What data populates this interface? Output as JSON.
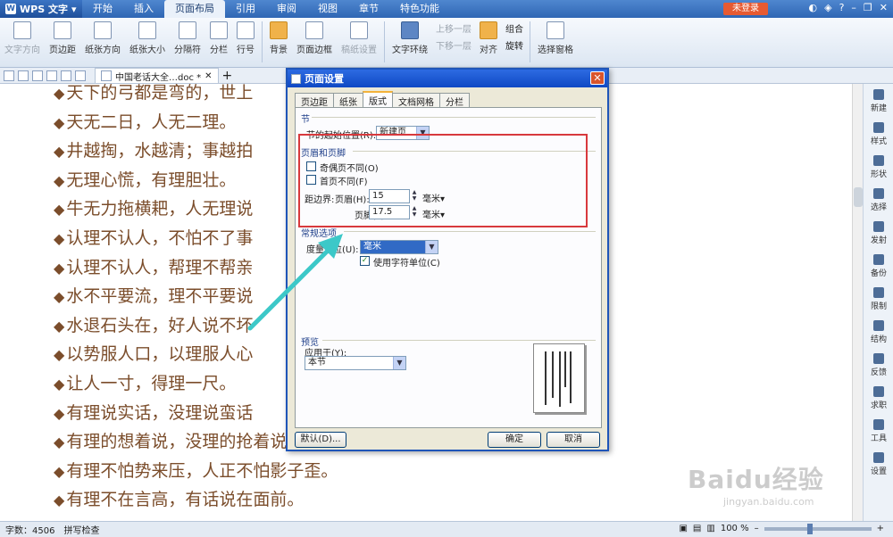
{
  "app": {
    "name": "WPS 文字",
    "login": "未登录"
  },
  "menu": [
    "开始",
    "插入",
    "页面布局",
    "引用",
    "审阅",
    "视图",
    "章节",
    "特色功能"
  ],
  "ribbon": {
    "text_direction": "文字方向",
    "margins": "页边距",
    "orientation": "纸张方向",
    "size": "纸张大小",
    "separator": "分隔符",
    "columns": "分栏",
    "line_numbers": "行号",
    "background": "背景",
    "page_border": "页面边框",
    "draft_settings": "稿纸设置",
    "text_wrap": "文字环绕",
    "bring_forward": "上移一层",
    "send_backward": "下移一层",
    "align": "对齐",
    "group": "组合",
    "rotate": "旋转",
    "selection_pane": "选择窗格"
  },
  "doc_tab": {
    "title": "中国老话大全…doc *"
  },
  "document": {
    "lines": [
      "天下的弓都是弯的，世上",
      "天无二日，人无二理。",
      "井越掏，水越清；事越拍",
      "无理心慌，有理胆壮。",
      "牛无力拖横耙，人无理说",
      "认理不认人，不怕不了事",
      "认理不认人，帮理不帮亲",
      "水不平要流，理不平要说",
      "水退石头在，好人说不坏",
      "以势服人口，以理服人心",
      "让人一寸，得理一尺。",
      "有理说实话，没理说蛮话",
      "有理的想着说，没理的抢着说",
      "有理不怕势来压，人正不怕影子歪。",
      "有理不在言高，有话说在面前。"
    ]
  },
  "sidebar": [
    "新建",
    "样式",
    "形状",
    "选择",
    "发射",
    "备份",
    "限制",
    "结构",
    "反馈",
    "求职",
    "工具",
    "设置"
  ],
  "status": {
    "words": "字数：4506",
    "spell": "拼写检查",
    "zoom": "100 %"
  },
  "watermark": {
    "main": "Baidu经验",
    "sub": "jingyan.baidu.com"
  },
  "dialog": {
    "title": "页面设置",
    "tabs": [
      "页边距",
      "纸张",
      "版式",
      "文档网格",
      "分栏"
    ],
    "section_heading": "节",
    "section_start_label": "节的起始位置(R):",
    "section_start_value": "新建页",
    "header_footer_heading": "页眉和页脚",
    "odd_even_label": "奇偶页不同(O)",
    "first_page_label": "首页不同(F)",
    "distance_label": "距边界:",
    "header_label": "页眉(H):",
    "header_value": "15",
    "footer_label": "页脚(F):",
    "footer_value": "17.5",
    "unit_mm": "毫米",
    "common_heading": "常规选项",
    "measure_label": "度量单位(U):",
    "measure_value": "毫米",
    "char_unit_label": "使用字符单位(C)",
    "preview_heading": "预览",
    "apply_label": "应用于(Y):",
    "apply_value": "本节",
    "default_button": "默认(D)...",
    "ok_button": "确定",
    "cancel_button": "取消"
  },
  "colors": {
    "accent": "#2f66b4",
    "annotation_red": "#d8393d",
    "annotation_arrow": "#3cc8c8",
    "text_brown": "#7b4d2b"
  }
}
